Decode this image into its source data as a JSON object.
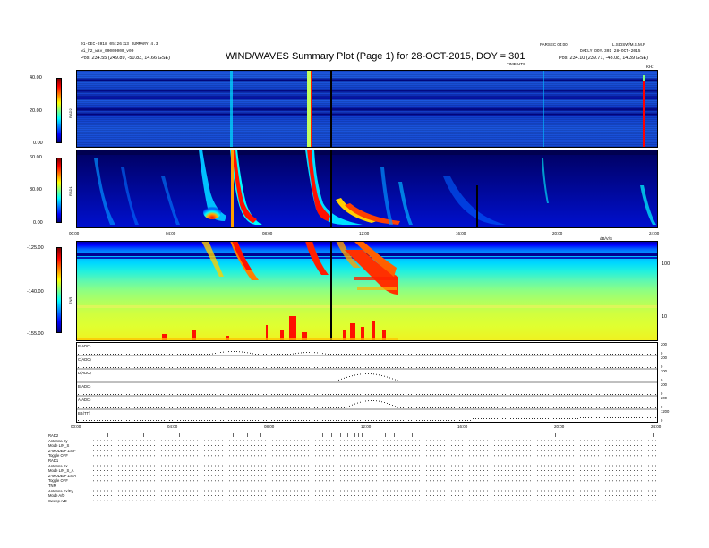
{
  "header": {
    "title": "WIND/WAVES Summary Plot (Page 1) for 28-OCT-2015, DOY = 301",
    "left_line1": "01-DEC-2018 05:26:13 SUMMARY 4.3",
    "left_line2": "wi_h2_wav_00000000_v00",
    "left_pos": "Pos:  234.55 (249.89, -50.83, 14.66 GSE)",
    "right_top": "PARSEC 04:00",
    "right_top2": "L.S.DSW/M.S.M.R",
    "right_line2": "DAILY  DOY.301  28-OCT-2015",
    "right_pos": "Pos:  234.10 (239.71, -48.08, 14.39 GSE)",
    "axis_unit": "TIME UTC",
    "corner_right": "KHz"
  },
  "panels": {
    "rad2": {
      "name": "RAD2",
      "ticks": [
        "40.00",
        "20.00",
        "0.00"
      ]
    },
    "rad1": {
      "name": "RAD1",
      "ticks": [
        "60.00",
        "30.00",
        "0.00"
      ]
    },
    "tnr": {
      "name": "TNR",
      "ticks": [
        "-125.00",
        "-140.00",
        "-155.00"
      ],
      "right_ticks": [
        "100",
        "10"
      ],
      "right_corner": "dB/V/S"
    },
    "hk_labels": [
      "B(ADC)",
      "C(ADC)",
      "D(ADC)",
      "B(ADC)",
      "A(ADC)",
      "BB(TT)"
    ],
    "hk_right": [
      [
        "200",
        "50",
        "0"
      ],
      [
        "200",
        "50",
        "0"
      ],
      [
        "200",
        "50",
        "0"
      ],
      [
        "200",
        "50",
        "0"
      ],
      [
        "200",
        "50",
        "0"
      ],
      [
        "1200",
        "200",
        "0"
      ]
    ]
  },
  "time_axis": {
    "labels": [
      "00:00",
      "04:00",
      "08:00",
      "12:00",
      "16:00",
      "20:00",
      "24:00"
    ],
    "bottom_labels": [
      "00:00",
      "04:00",
      "08:00",
      "12:00",
      "16:00",
      "20:00",
      "24:00"
    ]
  },
  "param_block": [
    "RAD2",
    "Antenna     Ey",
    "Mode     LIN_S",
    "Z-MODE/P  ZS-F",
    "Toggle      OFF",
    "RAD1",
    "Antenna     Sx",
    "Mode   LIN_S_A",
    "Z-MODE/P ZS-A",
    "Toggle      OFF",
    "TNR",
    "Antenna   Ex/Ey",
    "Mode        A/D",
    "Sweep       A/D"
  ],
  "chart_data": {
    "type": "heatmap",
    "title": "WIND/WAVES Summary Plot (Page 1) for 28-OCT-2015, DOY = 301",
    "x_range_hours": [
      0,
      24
    ],
    "series": [
      {
        "name": "RAD2",
        "colorbar_range": [
          0,
          40
        ],
        "events_hours": [
          6.3,
          9.5,
          23.6
        ]
      },
      {
        "name": "RAD1",
        "colorbar_range": [
          0,
          60
        ],
        "events_hours": [
          5.1,
          6.5,
          9.6,
          11.2
        ]
      },
      {
        "name": "TNR",
        "colorbar_range": [
          -155,
          -125
        ],
        "events_hours": [
          6.5,
          9.5,
          11.3,
          12.2
        ]
      }
    ],
    "colors": [
      "#000080",
      "#0000ff",
      "#0080ff",
      "#00ffff",
      "#80ff80",
      "#ffff00",
      "#ff8000",
      "#ff0000",
      "#800000"
    ]
  }
}
